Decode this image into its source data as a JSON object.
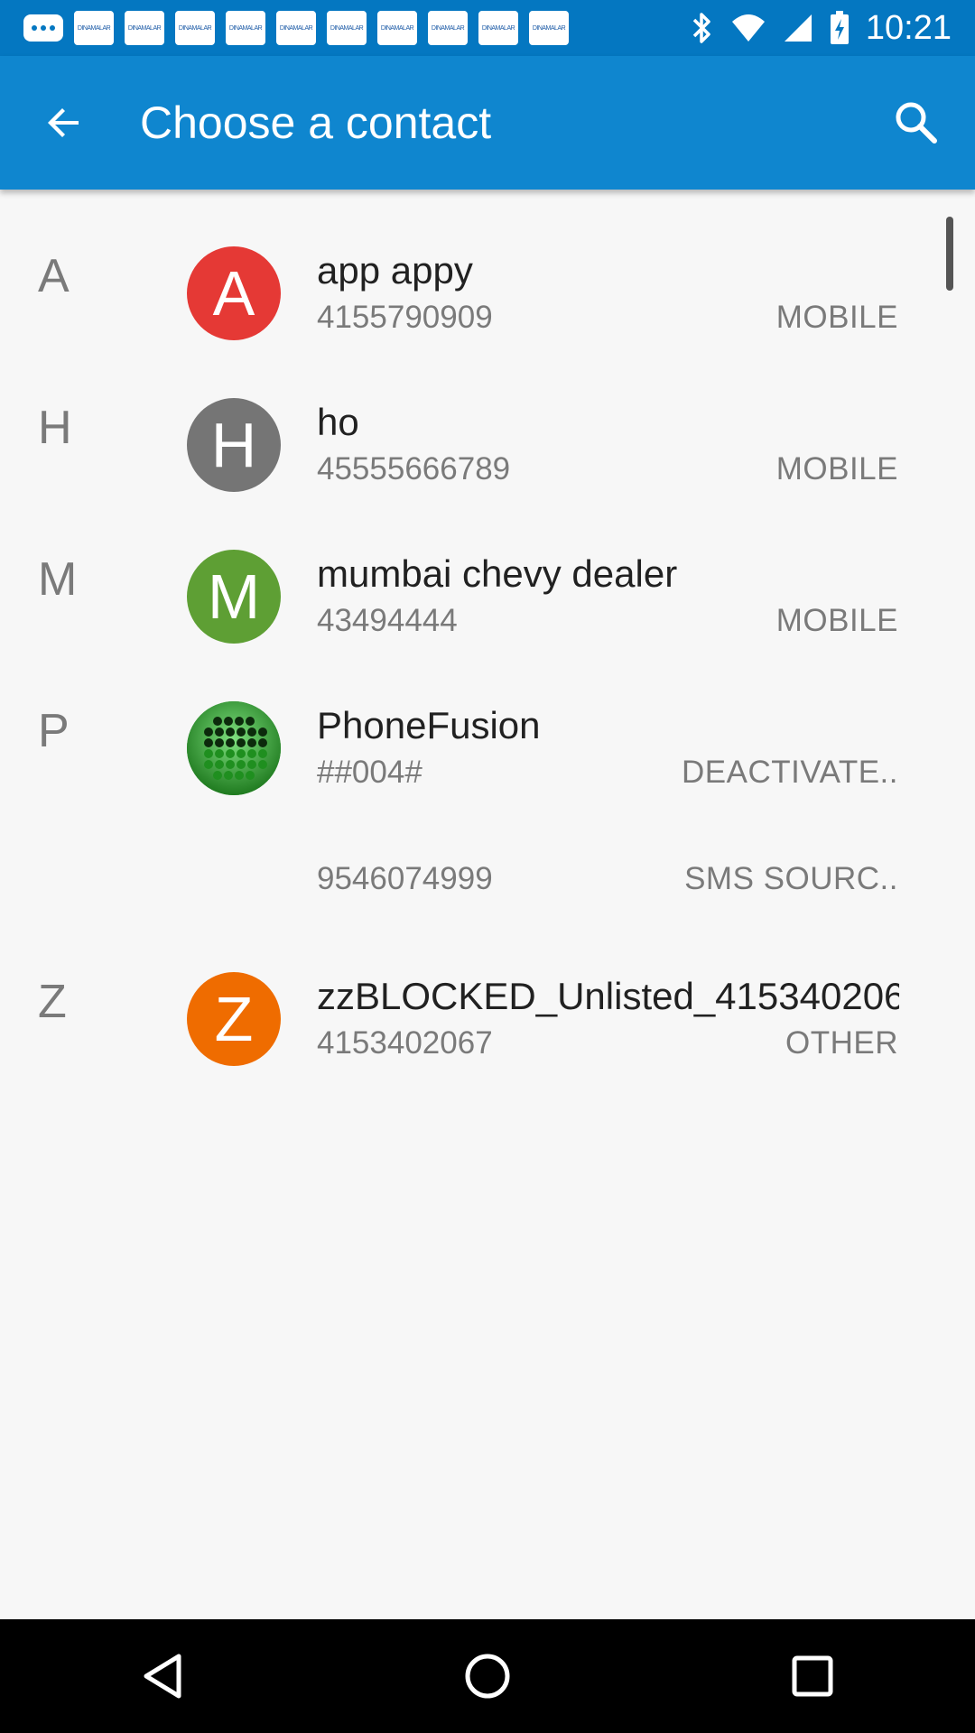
{
  "status_bar": {
    "time": "10:21",
    "notification_label": "DINAMALAR",
    "icons": [
      "more-icon",
      "notification-icon",
      "bluetooth-icon",
      "wifi-icon",
      "signal-icon",
      "battery-icon"
    ]
  },
  "app_bar": {
    "title": "Choose a contact",
    "color": "#0f86cf"
  },
  "contacts": [
    {
      "letter": "A",
      "initial": "A",
      "avatar_color": "#e53935",
      "name": "app appy",
      "number": "4155790909",
      "type": "MOBILE"
    },
    {
      "letter": "H",
      "initial": "H",
      "avatar_color": "#757575",
      "name": "ho",
      "number": "45555666789",
      "type": "MOBILE"
    },
    {
      "letter": "M",
      "initial": "M",
      "avatar_color": "#5e9f34",
      "name": "mumbai chevy dealer",
      "number": "43494444",
      "type": "MOBILE"
    },
    {
      "letter": "P",
      "initial": "",
      "avatar_color": "#2e9a2e",
      "name": "PhoneFusion",
      "number": "##004#",
      "type": "DEACTIVATE..",
      "extra_number": "9546074999",
      "extra_type": "SMS SOURC.."
    },
    {
      "letter": "Z",
      "initial": "Z",
      "avatar_color": "#ef6c00",
      "name": "zzBLOCKED_Unlisted_415340206..",
      "number": "4153402067",
      "type": "OTHER"
    }
  ],
  "nav_bar": {
    "icons": [
      "back-nav-icon",
      "home-nav-icon",
      "recents-nav-icon"
    ]
  }
}
